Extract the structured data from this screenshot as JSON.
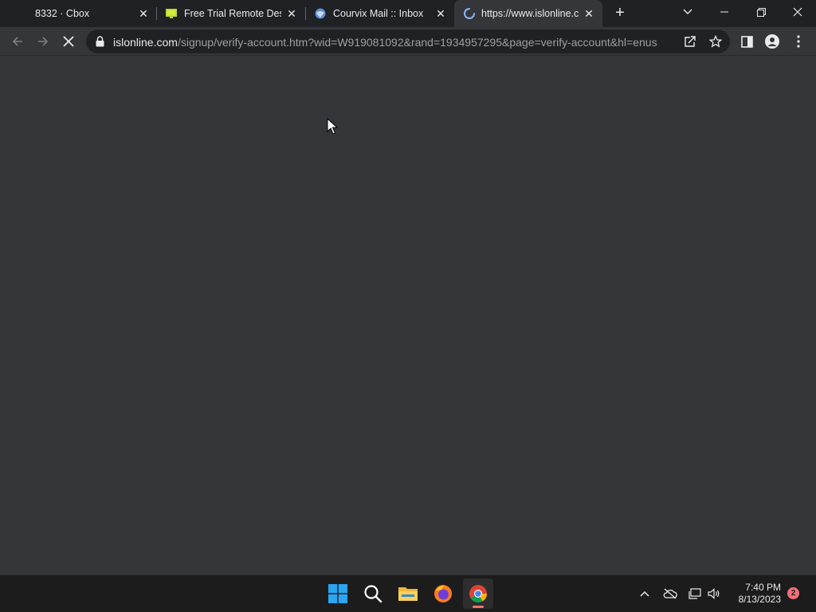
{
  "browser": {
    "tabs": [
      {
        "title": "8332 · Cbox",
        "close": "✕"
      },
      {
        "title": "Free Trial Remote Deskt",
        "close": "✕"
      },
      {
        "title": "Courvix Mail :: Inbox",
        "close": "✕"
      },
      {
        "title": "https://www.islonline.co",
        "close": "✕",
        "active": true
      }
    ],
    "new_tab": "+",
    "address": {
      "host": "islonline.com",
      "path": "/signup/verify-account.htm?wid=W919081092&rand=1934957295&page=verify-account&hl=enus"
    }
  },
  "taskbar": {
    "time": "7:40 PM",
    "date": "8/13/2023",
    "notifications": "2"
  },
  "colors": {
    "page_bg": "#35363a",
    "tabstrip_bg": "#202124",
    "taskbar_bg": "#1c1c1c",
    "accent": "#f2746b"
  }
}
